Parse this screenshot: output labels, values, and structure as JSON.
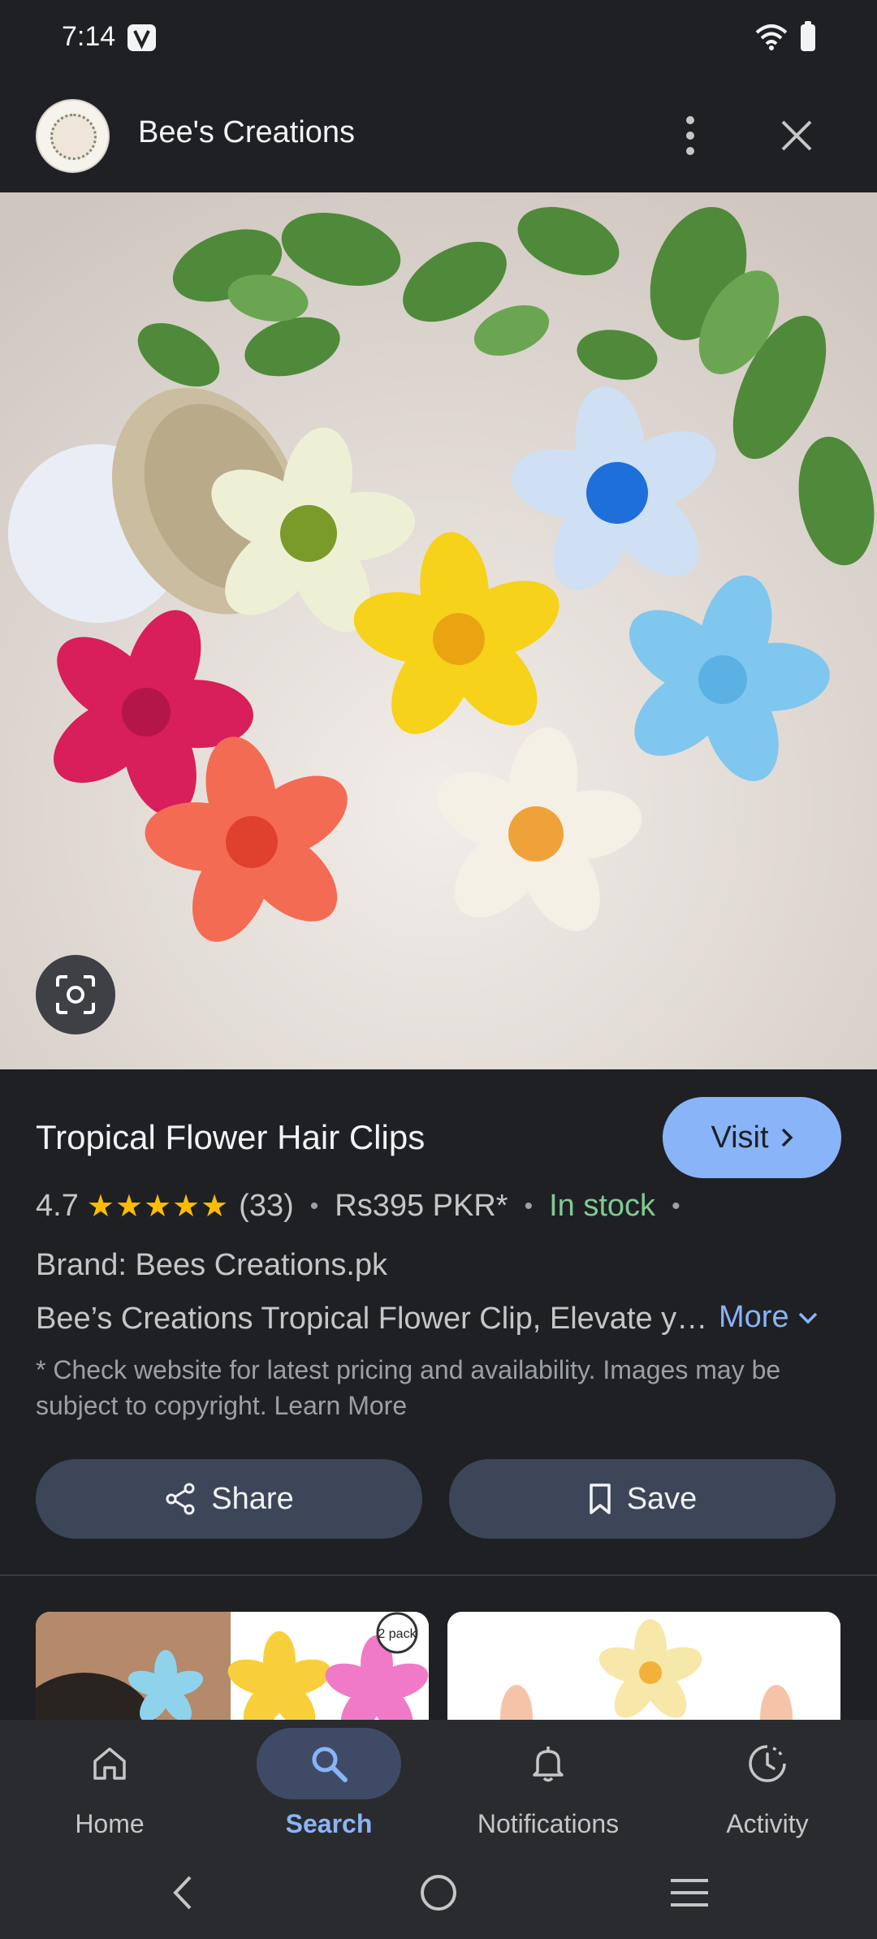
{
  "status_bar": {
    "time": "7:14"
  },
  "header": {
    "title": "Bee's Creations"
  },
  "product": {
    "title": "Tropical Flower Hair Clips",
    "visit_label": "Visit",
    "rating": "4.7",
    "stars": "★★★★★",
    "review_count": "(33)",
    "price": "Rs395 PKR*",
    "availability": "In stock",
    "brand": "Brand: Bees Creations.pk",
    "description": "Bee’s Creations Tropical Flower Clip, Elevate your style",
    "more_label": "More",
    "disclaimer": "* Check website for latest pricing and availability. Images may be subject to copyright. Learn More"
  },
  "actions": {
    "share_label": "Share",
    "save_label": "Save"
  },
  "related": {
    "badge": "2 pack"
  },
  "bottom_nav": {
    "items": [
      {
        "label": "Home",
        "icon": "home-icon"
      },
      {
        "label": "Search",
        "icon": "search-icon",
        "active": true
      },
      {
        "label": "Notifications",
        "icon": "bell-icon"
      },
      {
        "label": "Activity",
        "icon": "activity-icon"
      }
    ]
  },
  "colors": {
    "background": "#1f2024",
    "accent": "#8ab4f8",
    "in_stock": "#81c995",
    "star": "#fbbc04",
    "button": "#3c4658"
  }
}
